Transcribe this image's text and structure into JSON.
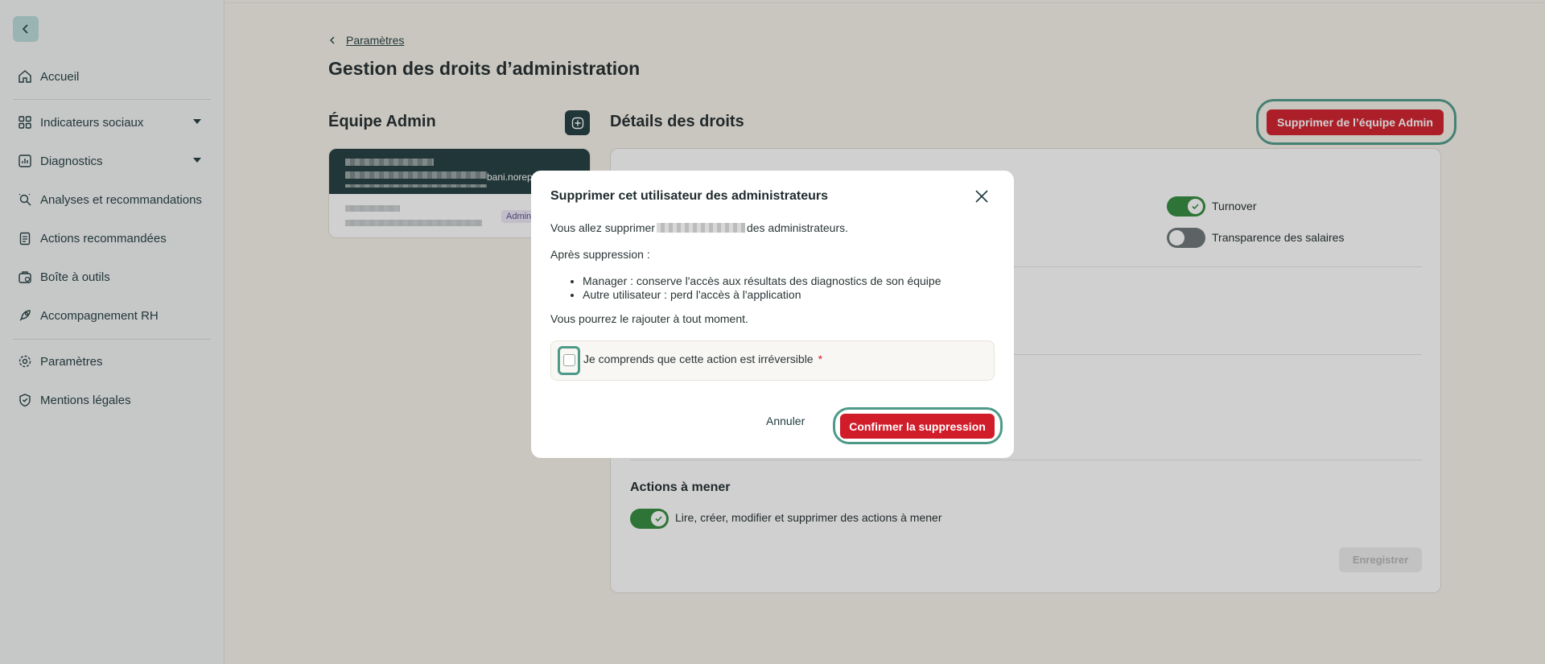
{
  "sidebar": {
    "items": [
      {
        "label": "Accueil",
        "icon": "home-icon"
      },
      {
        "label": "Indicateurs sociaux",
        "icon": "grid-icon",
        "expandable": true
      },
      {
        "label": "Diagnostics",
        "icon": "chart-icon",
        "expandable": true
      },
      {
        "label": "Analyses et recommandations",
        "icon": "analysis-icon"
      },
      {
        "label": "Actions recommandées",
        "icon": "clipboard-icon"
      },
      {
        "label": "Boîte à outils",
        "icon": "toolbox-icon"
      },
      {
        "label": "Accompagnement RH",
        "icon": "rocket-icon"
      },
      {
        "label": "Paramètres",
        "icon": "gear-icon"
      },
      {
        "label": "Mentions légales",
        "icon": "shield-check-icon"
      }
    ]
  },
  "breadcrumb": {
    "link": "Paramètres"
  },
  "page": {
    "title": "Gestion des droits d’administration"
  },
  "team": {
    "title": "Équipe Admin",
    "card": {
      "email_fragment": "bani.norep",
      "badge": "Admin"
    }
  },
  "details": {
    "title": "Détails des droits",
    "remove_button": "Supprimer de l’équipe Admin",
    "toggles": [
      {
        "label": "Turnover",
        "enabled": true
      },
      {
        "label": "Transparence des salaires",
        "enabled": false
      }
    ],
    "actions_section": {
      "title": "Actions à mener",
      "toggle_label": "Lire, créer, modifier et supprimer des actions à mener",
      "enabled": true
    },
    "save_button": "Enregistrer"
  },
  "modal": {
    "title": "Supprimer cet utilisateur des administrateurs",
    "intro_before": "Vous allez supprimer",
    "intro_after": "des administrateurs.",
    "after_label": "Après suppression :",
    "list": [
      "Manager : conserve l'accès aux résultats des diagnostics de son équipe",
      "Autre utilisateur : perd l'accès à l'application"
    ],
    "readd_text": "Vous pourrez le rajouter à tout moment.",
    "checkbox_label": "Je comprends que cette action est irréversible",
    "required_mark": "*",
    "checkbox_checked": false,
    "cancel": "Annuler",
    "confirm": "Confirmer la suppression"
  },
  "colors": {
    "primary_dark": "#1f3a3d",
    "danger": "#d11d2a",
    "focus_ring": "#4e9a88",
    "toggle_on": "#2f8a3a"
  }
}
